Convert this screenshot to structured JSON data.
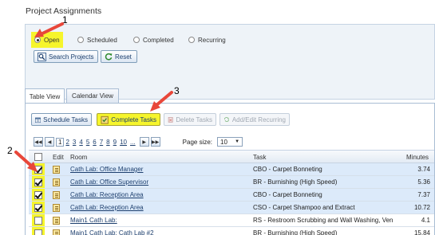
{
  "page": {
    "title": "Project Assignments"
  },
  "filters": {
    "options": [
      {
        "label": "Open",
        "selected": true
      },
      {
        "label": "Scheduled",
        "selected": false
      },
      {
        "label": "Completed",
        "selected": false
      },
      {
        "label": "Recurring",
        "selected": false
      }
    ],
    "search_label": "Search Projects",
    "reset_label": "Reset"
  },
  "tabs": [
    {
      "label": "Table View",
      "active": true
    },
    {
      "label": "Calendar View",
      "active": false
    }
  ],
  "toolbar": {
    "schedule_label": "Schedule Tasks",
    "complete_label": "Complete Tasks",
    "delete_label": "Delete Tasks",
    "recurring_label": "Add/Edit Recurring"
  },
  "pager": {
    "first": "◀◀",
    "prev": "◀",
    "pages": [
      "1",
      "2",
      "3",
      "4",
      "5",
      "6",
      "7",
      "8",
      "9",
      "10",
      "..."
    ],
    "current": "1",
    "next": "▶",
    "last": "▶▶",
    "page_size_label": "Page size:",
    "page_size": "10"
  },
  "table": {
    "headers": {
      "edit": "Edit",
      "room": "Room",
      "task": "Task",
      "minutes": "Minutes"
    },
    "rows": [
      {
        "checked": true,
        "room": "Cath Lab: Office Manager",
        "task": "CBO - Carpet Bonneting",
        "minutes": "3.74"
      },
      {
        "checked": true,
        "room": "Cath Lab: Office Supervisor",
        "task": "BR - Burnishing (High Speed)",
        "minutes": "5.36"
      },
      {
        "checked": true,
        "room": "Cath Lab: Reception Area",
        "task": "CBO - Carpet Bonneting",
        "minutes": "7.37"
      },
      {
        "checked": true,
        "room": "Cath Lab: Reception Area",
        "task": "CSO - Carpet Shampoo and Extract",
        "minutes": "10.72"
      },
      {
        "checked": false,
        "room": "Main1 Cath Lab:",
        "task": "RS - Restroom Scrubbing and Wall Washing, Vents",
        "minutes": "4.1"
      },
      {
        "checked": false,
        "room": "Main1 Cath Lab: Cath Lab #2",
        "task": "BR - Burnishing (High Speed)",
        "minutes": "15.84"
      }
    ]
  },
  "annotations": [
    "1",
    "2",
    "3"
  ],
  "colors": {
    "highlight": "#f6f52c",
    "arrow": "#e8473a",
    "selected_row": "#dceafa"
  }
}
